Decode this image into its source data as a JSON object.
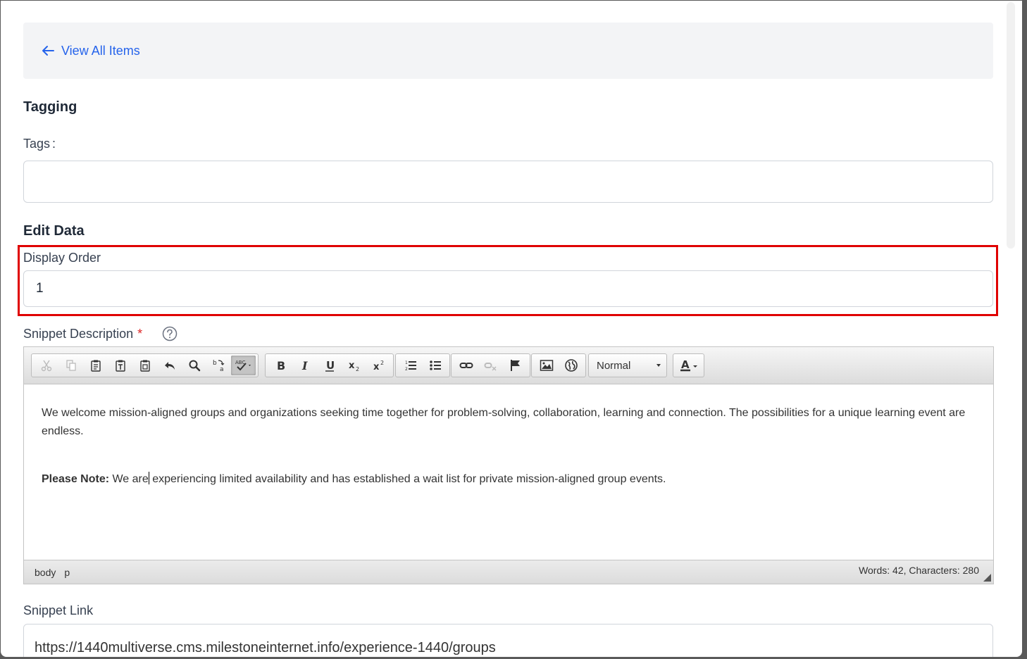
{
  "nav": {
    "back_label": "View All Items"
  },
  "tagging": {
    "heading": "Tagging",
    "tags_label": "Tags",
    "tags_colon": ":",
    "tags_value": ""
  },
  "edit": {
    "heading": "Edit Data",
    "display_order_label": "Display Order",
    "display_order_value": "1"
  },
  "snippet": {
    "description_label": "Snippet Description",
    "required_mark": "*",
    "link_label": "Snippet Link",
    "link_value": "https://1440multiverse.cms.milestoneinternet.info/experience-1440/groups"
  },
  "editor": {
    "format_value": "Normal",
    "paragraph1": "We welcome mission-aligned groups and organizations seeking time together for problem-solving, collaboration, learning and connection. The possibilities for a unique learning event are endless.",
    "note_label": "Please Note:",
    "note_text_before_caret": " We are",
    "note_text_after_caret": " experiencing limited availability and has established a wait list for private mission-aligned group events.",
    "path_body": "body",
    "path_p": "p",
    "word_count": "Words: 42, Characters: 280"
  },
  "colors": {
    "accent": "#2563eb",
    "highlight": "#e00000",
    "required": "#dc2626"
  }
}
